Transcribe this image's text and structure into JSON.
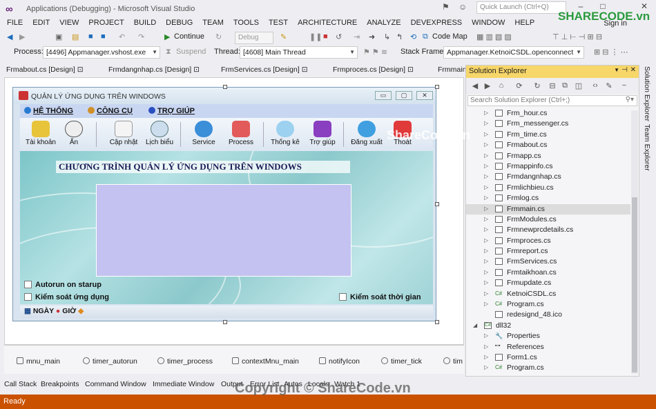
{
  "window": {
    "title": "Applications (Debugging) - Microsoft Visual Studio",
    "quick_launch_placeholder": "Quick Launch (Ctrl+Q)",
    "sign_in": "Sign in"
  },
  "menu": [
    "FILE",
    "EDIT",
    "VIEW",
    "PROJECT",
    "BUILD",
    "DEBUG",
    "TEAM",
    "TOOLS",
    "TEST",
    "ARCHITECTURE",
    "ANALYZE",
    "DEVEXPRESS",
    "WINDOW",
    "HELP"
  ],
  "toolbar": {
    "continue_label": "Continue",
    "config_value": "Debug",
    "code_map_label": "Code Map",
    "process_label": "Process:",
    "process_value": "[4496] Appmanager.vshost.exe",
    "suspend_label": "Suspend",
    "thread_label": "Thread:",
    "thread_value": "[4608] Main Thread",
    "stack_frame_label": "Stack Frame:",
    "stack_frame_value": "Appmanager.KetnoiCSDL.openconnect"
  },
  "doc_tabs": [
    "Frmabout.cs [Design]",
    "Frmdangnhap.cs [Design]",
    "FrmServices.cs [Design]",
    "Frmproces.cs [Design]",
    "Frmmain"
  ],
  "form": {
    "title": "QUẢN LÝ ỨNG DỤNG TRÊN WINDOWS",
    "menu": [
      "HỆ THỐNG",
      "CÔNG CỤ",
      "TRỢ GIÚP"
    ],
    "toolbar": [
      "Tài khoản",
      "Ẩn",
      "Cập nhật",
      "Lịch biểu",
      "Service",
      "Process",
      "Thống kê",
      "Trợ giúp",
      "Đăng xuất",
      "Thoát"
    ],
    "headline": "CHƯƠNG TRÌNH QUẢN LÝ ỨNG DỤNG TRÊN WINDOWS",
    "checkbox_autorun": "Autorun on starup",
    "checkbox_control_apps": "Kiểm soát ứng dụng",
    "checkbox_control_time": "Kiểm soát thời gian",
    "status_date": "NGÀY",
    "status_time": "GIỜ"
  },
  "component_tray": [
    "mnu_main",
    "timer_autorun",
    "timer_process",
    "contextMnu_main",
    "notifyIcon",
    "timer_tick",
    "tim"
  ],
  "bottom_tabs": [
    "Call Stack",
    "Breakpoints",
    "Command Window",
    "Immediate Window",
    "Output",
    "Error List",
    "Autos",
    "Locals",
    "Watch 1"
  ],
  "status": "Ready",
  "solution_explorer": {
    "title": "Solution Explorer",
    "search_placeholder": "Search Solution Explorer (Ctrl+;)",
    "items": [
      {
        "label": "Frm_hour.cs",
        "kind": "form"
      },
      {
        "label": "Frm_messenger.cs",
        "kind": "form"
      },
      {
        "label": "Frm_time.cs",
        "kind": "form"
      },
      {
        "label": "Frmabout.cs",
        "kind": "form"
      },
      {
        "label": "Frmapp.cs",
        "kind": "form"
      },
      {
        "label": "Frmappinfo.cs",
        "kind": "form"
      },
      {
        "label": "Frmdangnhap.cs",
        "kind": "form"
      },
      {
        "label": "Frmlichbieu.cs",
        "kind": "form"
      },
      {
        "label": "Frmlog.cs",
        "kind": "form"
      },
      {
        "label": "Frmmain.cs",
        "kind": "form",
        "selected": true
      },
      {
        "label": "FrmModules.cs",
        "kind": "form"
      },
      {
        "label": "Frmnewprcdetails.cs",
        "kind": "form"
      },
      {
        "label": "Frmproces.cs",
        "kind": "form"
      },
      {
        "label": "Frmreport.cs",
        "kind": "form"
      },
      {
        "label": "FrmServices.cs",
        "kind": "form"
      },
      {
        "label": "Frmtaikhoan.cs",
        "kind": "form"
      },
      {
        "label": "Frmupdate.cs",
        "kind": "form"
      },
      {
        "label": "KetnoiCSDL.cs",
        "kind": "cs"
      },
      {
        "label": "Program.cs",
        "kind": "cs"
      },
      {
        "label": "redesignd_48.ico",
        "kind": "ico"
      },
      {
        "label": "dll32",
        "kind": "project"
      },
      {
        "label": "Properties",
        "kind": "props"
      },
      {
        "label": "References",
        "kind": "refs"
      },
      {
        "label": "Form1.cs",
        "kind": "form"
      },
      {
        "label": "Program.cs",
        "kind": "cs"
      }
    ]
  },
  "side_tabs": [
    "Solution Explorer",
    "Team Explorer"
  ],
  "watermarks": {
    "logo": "SHARECODE.vn",
    "mid": "ShareCode.vn",
    "footer": "Copyright © ShareCode.vn"
  },
  "colors": {
    "status_bar": "#ca5100",
    "solution_header": "#f7d66a",
    "form_menu": "#c9d6f2",
    "panel": "#c3c2f0"
  }
}
